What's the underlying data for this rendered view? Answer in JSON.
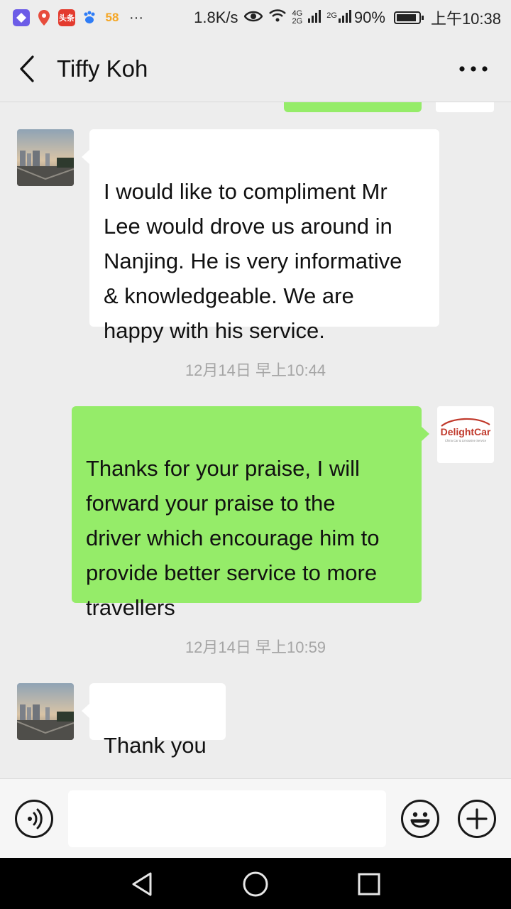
{
  "status_bar": {
    "apps": [
      {
        "icon": "app-diamond-icon",
        "color": "#6c5ce7",
        "label": ""
      },
      {
        "icon": "map-pin-icon",
        "color": "#e74c3c",
        "label": ""
      },
      {
        "icon": "toutiao-icon",
        "color": "#e33b2e",
        "label": "头条"
      },
      {
        "icon": "baidu-paw-icon",
        "color": "#2f7df6",
        "label": ""
      },
      {
        "icon": "app-58-icon",
        "color": "#f5a623",
        "label": "58"
      }
    ],
    "more": "···",
    "speed": "1.8K/s",
    "net1_top": "4G",
    "net1_bottom": "2G",
    "net2": "2G",
    "battery": "90%",
    "battery_level": 0.9,
    "time": "上午10:38"
  },
  "header": {
    "title": "Tiffy Koh"
  },
  "messages": {
    "m1": {
      "text": "I would like to compliment Mr\nLee would drove us around in\nNanjing. He is very informative\n& knowledgeable.  We are\nhappy with his service."
    },
    "ts1": "12月14日 早上10:44",
    "m2": {
      "text": "Thanks for your praise, I will\nforward your praise to the\ndriver which encourage him to\nprovide better service to more\ntravellers",
      "avatar_logo": "DelightCar",
      "avatar_sub": "China Car & Limousine Service"
    },
    "ts2": "12月14日 早上10:59",
    "m3": {
      "text": "Thank you"
    }
  },
  "input": {
    "value": ""
  },
  "colors": {
    "incoming_bubble": "#ffffff",
    "outgoing_bubble": "#95ec69",
    "background": "#ededed",
    "logo_red": "#c0392b"
  }
}
